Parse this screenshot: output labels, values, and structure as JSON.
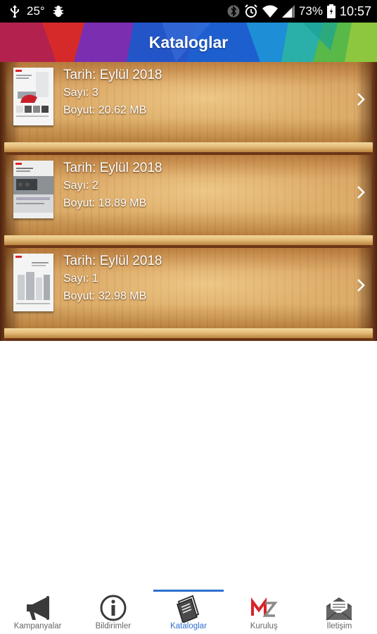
{
  "status_bar": {
    "temperature": "25°",
    "battery": "73%",
    "time": "10:57",
    "left_icons": [
      "usb-icon",
      "bug-icon"
    ],
    "right_icons": [
      "bluetooth-icon",
      "alarm-icon",
      "wifi-icon",
      "signal-icon",
      "battery-icon"
    ]
  },
  "header": {
    "title": "Kataloglar",
    "colors": [
      "#c2285a",
      "#d62a2a",
      "#7b2fb0",
      "#2455c8",
      "#1e8fd6",
      "#2ab0a8",
      "#58b848",
      "#8dc63f"
    ]
  },
  "catalogs": [
    {
      "date": "Tarih: Eylül 2018",
      "issue": "Sayı: 3",
      "size": "Boyut: 20.62 MB"
    },
    {
      "date": "Tarih: Eylül 2018",
      "issue": "Sayı: 2",
      "size": "Boyut: 18.89 MB"
    },
    {
      "date": "Tarih: Eylül 2018",
      "issue": "Sayı: 1",
      "size": "Boyut: 32.98 MB"
    }
  ],
  "bottom_nav": {
    "active": "Kataloglar",
    "active_color": "#2f6fd0",
    "items": [
      {
        "label": "Kampanyalar",
        "icon": "megaphone-icon"
      },
      {
        "label": "Bildirimler",
        "icon": "info-icon"
      },
      {
        "label": "Kataloglar",
        "icon": "catalog-icon"
      },
      {
        "label": "Kuruluş",
        "icon": "brand-logo-icon"
      },
      {
        "label": "İletişim",
        "icon": "mail-icon"
      }
    ]
  }
}
